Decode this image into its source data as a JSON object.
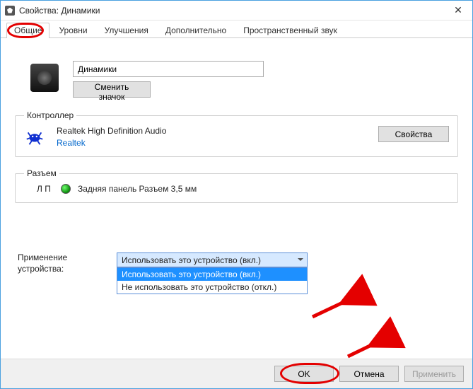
{
  "window": {
    "title": "Свойства: Динамики"
  },
  "tabs": {
    "general": "Общие",
    "levels": "Уровни",
    "enhancements": "Улучшения",
    "advanced": "Дополнительно",
    "spatial": "Пространственный звук"
  },
  "device": {
    "name": "Динамики",
    "change_icon": "Сменить значок"
  },
  "controller": {
    "legend": "Контроллер",
    "name": "Realtek High Definition Audio",
    "vendor": "Realtek",
    "properties_btn": "Свойства"
  },
  "jack": {
    "legend": "Разъем",
    "side": "Л П",
    "desc": "Задняя панель Разъем 3,5 мм"
  },
  "usage": {
    "label": "Применение устройства:",
    "selected": "Использовать это устройство (вкл.)",
    "options": [
      "Использовать это устройство (вкл.)",
      "Не использовать это устройство (откл.)"
    ]
  },
  "footer": {
    "ok": "OK",
    "cancel": "Отмена",
    "apply": "Применить"
  }
}
